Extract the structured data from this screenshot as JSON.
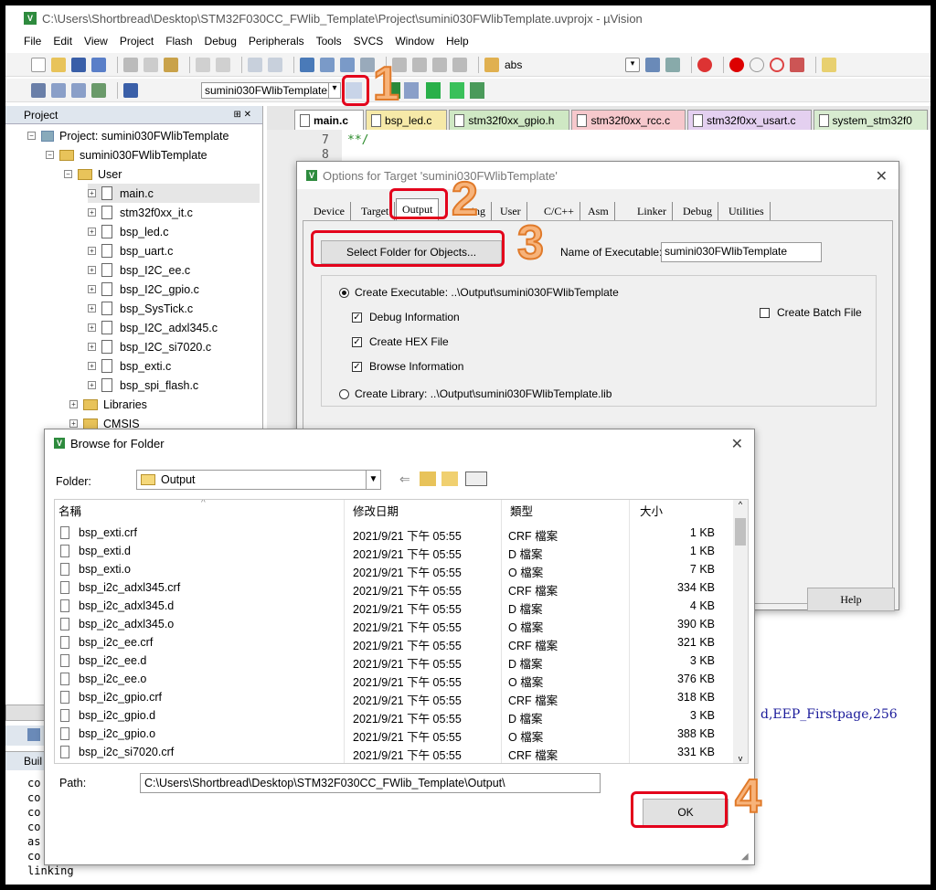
{
  "window": {
    "title": "C:\\Users\\Shortbread\\Desktop\\STM32F030CC_FWlib_Template\\Project\\sumini030FWlibTemplate.uvprojx - µVision"
  },
  "menu": [
    "File",
    "Edit",
    "View",
    "Project",
    "Flash",
    "Debug",
    "Peripherals",
    "Tools",
    "SVCS",
    "Window",
    "Help"
  ],
  "toolbar": {
    "find_text": "abs",
    "target": "sumini030FWlibTemplate"
  },
  "project": {
    "panel_title": "Project",
    "root": "Project: sumini030FWlibTemplate",
    "target": "sumini030FWlibTemplate",
    "group_user": "User",
    "files": [
      "main.c",
      "stm32f0xx_it.c",
      "bsp_led.c",
      "bsp_uart.c",
      "bsp_I2C_ee.c",
      "bsp_I2C_gpio.c",
      "bsp_SysTick.c",
      "bsp_I2C_adxl345.c",
      "bsp_I2C_si7020.c",
      "bsp_exti.c",
      "bsp_spi_flash.c"
    ],
    "groups": [
      "Libraries",
      "CMSIS"
    ]
  },
  "editor": {
    "tabs": [
      "main.c",
      "bsp_led.c",
      "stm32f0xx_gpio.h",
      "stm32f0xx_rcc.c",
      "stm32f0xx_usart.c",
      "system_stm32f0"
    ],
    "lines": [
      {
        "num": "7",
        "text": "**/"
      },
      {
        "num": "8",
        "text": ""
      }
    ],
    "code_fragment": "d,EEP_Firstpage,256"
  },
  "build": {
    "title": "Buil",
    "lines": [
      "co",
      "co",
      "co",
      "co",
      "as",
      "co",
      "linking"
    ]
  },
  "options_dialog": {
    "title": "Options for Target 'sumini030FWlibTemplate'",
    "tabs": [
      "Device",
      "Target",
      "Output",
      "Listing",
      "User",
      "C/C++",
      "Asm",
      "Linker",
      "Debug",
      "Utilities"
    ],
    "select_folder_button": "Select Folder for Objects...",
    "name_exec_label": "Name of Executable:",
    "name_exec_value": "sumini030FWlibTemplate",
    "create_exec": "Create Executable:  ..\\Output\\sumini030FWlibTemplate",
    "debug_info": "Debug Information",
    "create_hex": "Create HEX File",
    "browse_info": "Browse Information",
    "create_batch": "Create Batch File",
    "create_lib": "Create Library:  ..\\Output\\sumini030FWlibTemplate.lib",
    "help_button": "Help"
  },
  "browse_dialog": {
    "title": "Browse for Folder",
    "folder_label": "Folder:",
    "folder_value": "Output",
    "columns": {
      "name": "名稱",
      "date": "修改日期",
      "type": "類型",
      "size": "大小"
    },
    "rows": [
      {
        "name": "bsp_exti.crf",
        "date": "2021/9/21 下午 05:55",
        "type": "CRF 檔案",
        "size": "1 KB"
      },
      {
        "name": "bsp_exti.d",
        "date": "2021/9/21 下午 05:55",
        "type": "D 檔案",
        "size": "1 KB"
      },
      {
        "name": "bsp_exti.o",
        "date": "2021/9/21 下午 05:55",
        "type": "O 檔案",
        "size": "7 KB"
      },
      {
        "name": "bsp_i2c_adxl345.crf",
        "date": "2021/9/21 下午 05:55",
        "type": "CRF 檔案",
        "size": "334 KB"
      },
      {
        "name": "bsp_i2c_adxl345.d",
        "date": "2021/9/21 下午 05:55",
        "type": "D 檔案",
        "size": "4 KB"
      },
      {
        "name": "bsp_i2c_adxl345.o",
        "date": "2021/9/21 下午 05:55",
        "type": "O 檔案",
        "size": "390 KB"
      },
      {
        "name": "bsp_i2c_ee.crf",
        "date": "2021/9/21 下午 05:55",
        "type": "CRF 檔案",
        "size": "321 KB"
      },
      {
        "name": "bsp_i2c_ee.d",
        "date": "2021/9/21 下午 05:55",
        "type": "D 檔案",
        "size": "3 KB"
      },
      {
        "name": "bsp_i2c_ee.o",
        "date": "2021/9/21 下午 05:55",
        "type": "O 檔案",
        "size": "376 KB"
      },
      {
        "name": "bsp_i2c_gpio.crf",
        "date": "2021/9/21 下午 05:55",
        "type": "CRF 檔案",
        "size": "318 KB"
      },
      {
        "name": "bsp_i2c_gpio.d",
        "date": "2021/9/21 下午 05:55",
        "type": "D 檔案",
        "size": "3 KB"
      },
      {
        "name": "bsp_i2c_gpio.o",
        "date": "2021/9/21 下午 05:55",
        "type": "O 檔案",
        "size": "388 KB"
      },
      {
        "name": "bsp_i2c_si7020.crf",
        "date": "2021/9/21 下午 05:55",
        "type": "CRF 檔案",
        "size": "331 KB"
      }
    ],
    "path_label": "Path:",
    "path_value": "C:\\Users\\Shortbread\\Desktop\\STM32F030CC_FWlib_Template\\Output\\",
    "ok_button": "OK"
  },
  "callouts": [
    "1",
    "2",
    "3",
    "4"
  ]
}
